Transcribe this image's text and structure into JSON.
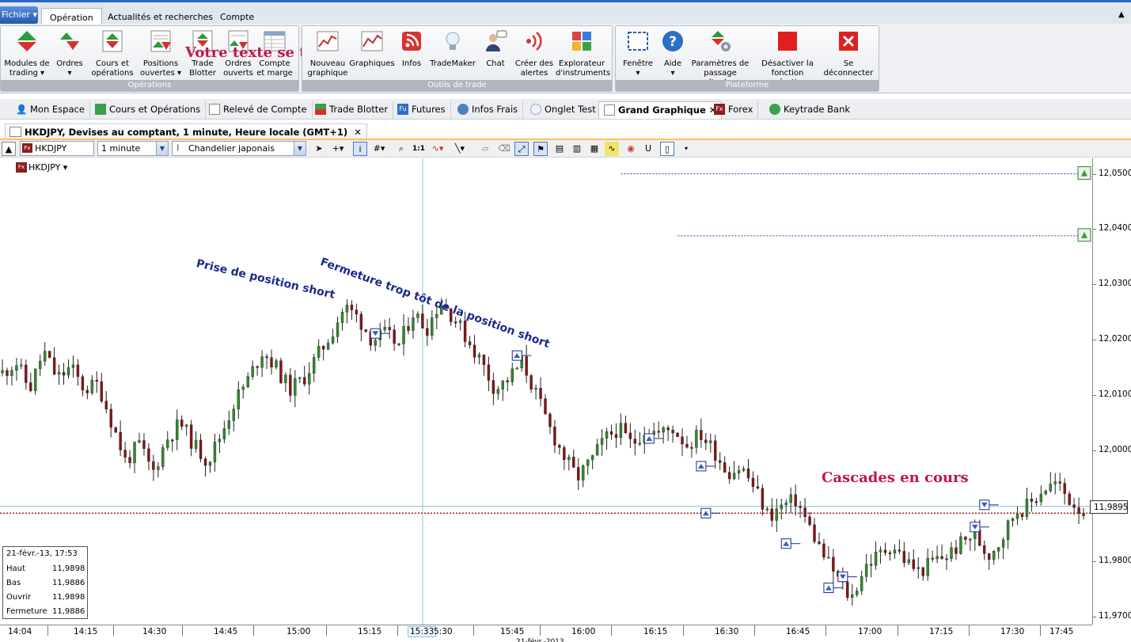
{
  "menu": {
    "file_label": "Fichier",
    "tabs": [
      "Opération",
      "Actualités et recherches",
      "Compte"
    ]
  },
  "ribbon": {
    "operations": {
      "label": "Opérations",
      "buttons": [
        {
          "l1": "Modules de",
          "l2": "trading ▾"
        },
        {
          "l1": "Ordres",
          "l2": "▾"
        },
        {
          "l1": "Cours et",
          "l2": "opérations ▾"
        },
        {
          "l1": "Positions",
          "l2": "ouvertes ▾"
        },
        {
          "l1": "Trade",
          "l2": "Blotter"
        },
        {
          "l1": "Ordres",
          "l2": "ouverts"
        },
        {
          "l1": "Compte",
          "l2": "et marge"
        }
      ]
    },
    "outils": {
      "label": "Outils de trade",
      "buttons": [
        {
          "l1": "Nouveau",
          "l2": "graphique"
        },
        {
          "l1": "Graphiques",
          "l2": ""
        },
        {
          "l1": "Infos",
          "l2": ""
        },
        {
          "l1": "TradeMaker",
          "l2": ""
        },
        {
          "l1": "Chat",
          "l2": ""
        },
        {
          "l1": "Créer des",
          "l2": "alertes"
        },
        {
          "l1": "Explorateur",
          "l2": "d'instruments"
        }
      ]
    },
    "plateforme": {
      "label": "Plateforme",
      "buttons": [
        {
          "l1": "Fenêtre",
          "l2": "▾"
        },
        {
          "l1": "Aide",
          "l2": "▾"
        },
        {
          "l1": "Paramètres de",
          "l2": "passage d'ordre"
        },
        {
          "l1": "Désactiver la",
          "l2": "fonction opération"
        },
        {
          "l1": "Se",
          "l2": "déconnecter"
        }
      ]
    },
    "overlay_text": "Votre texte se trouve ici."
  },
  "workspace_tabs": [
    "Mon Espace",
    "Cours et Opérations",
    "Relevé de Compte",
    "Trade Blotter",
    "Futures",
    "Infos Frais",
    "Onglet Test",
    "Grand Graphique",
    "Forex",
    "Keytrade Bank"
  ],
  "doc_tab": "HKDJPY, Devises au comptant, 1 minute, Heure locale (GMT+1)",
  "chart_toolbar": {
    "symbol": "HKDJPY",
    "interval": "1 minute",
    "chart_style": "Chandelier japonais",
    "fx_badge": "Fx",
    "zoom_label": "1:1"
  },
  "annotations": {
    "a1": "Prise de position short",
    "a2": "Fermeture trop tôt de la position short",
    "a3": "Cascades en cours"
  },
  "ohlc": {
    "date": "21-févr.-13, 17:53",
    "rows": [
      {
        "k": "Haut",
        "v": "11,9898"
      },
      {
        "k": "Bas",
        "v": "11,9886"
      },
      {
        "k": "Ouvrir",
        "v": "11,9898"
      },
      {
        "k": "Fermeture",
        "v": "11,9886"
      }
    ]
  },
  "price_tag": "11,9895",
  "chart_data": {
    "type": "candlestick",
    "symbol": "HKDJPY",
    "x_ticks": [
      "14:04",
      "14:15",
      "14:30",
      "14:45",
      "15:00",
      "15:15",
      "15:33",
      "5:30",
      "15:45",
      "16:00",
      "16:15",
      "16:30",
      "16:45",
      "17:00",
      "17:15",
      "17:30",
      "17:45"
    ],
    "y_ticks": [
      "12,0500",
      "12,0400",
      "12,0300",
      "12,0200",
      "12,0100",
      "12,0000",
      "11,9900",
      "11,9800",
      "11,9700"
    ],
    "date_label": "21-févr.-2013",
    "ylim": [
      11.9685,
      12.0528
    ],
    "last_price": 11.9895,
    "crosshair_time": "15:33",
    "series": [
      {
        "name": "HKDJPY",
        "close_path": [
          12.014,
          12.016,
          12.011,
          12.018,
          12.013,
          12.015,
          12.011,
          12.012,
          12.005,
          11.998,
          12.001,
          11.996,
          12.002,
          12.005,
          12.001,
          11.998,
          12.003,
          12.009,
          12.013,
          12.018,
          12.015,
          12.011,
          12.013,
          12.017,
          12.021,
          12.026,
          12.024,
          12.02,
          12.021,
          12.019,
          12.025,
          12.022,
          12.027,
          12.024,
          12.02,
          12.016,
          12.011,
          12.013,
          12.016,
          12.01,
          12.004,
          11.999,
          11.995,
          11.998,
          12.002,
          12.004,
          12.001,
          12.004,
          12.003,
          12.004,
          12.001,
          12.003,
          12.0,
          11.996,
          11.997,
          11.993,
          11.988,
          11.99,
          11.991,
          11.986,
          11.981,
          11.977,
          11.973,
          11.979,
          11.981,
          11.983,
          11.98,
          11.978,
          11.98,
          11.981,
          11.983,
          11.985,
          11.981,
          11.984,
          11.989,
          11.99,
          11.993,
          11.994,
          11.991,
          11.989
        ],
        "alerts": [
          12.05,
          12.0388
        ]
      }
    ],
    "trade_markers": [
      {
        "time": "15:22",
        "price": 12.022,
        "dir": "down"
      },
      {
        "time": "15:52",
        "price": 12.018,
        "dir": "up"
      },
      {
        "time": "16:20",
        "price": 12.003,
        "dir": "up"
      },
      {
        "time": "16:31",
        "price": 11.998,
        "dir": "up"
      },
      {
        "time": "16:32",
        "price": 11.9895,
        "dir": "up"
      },
      {
        "time": "16:49",
        "price": 11.984,
        "dir": "up"
      },
      {
        "time": "16:58",
        "price": 11.976,
        "dir": "up"
      },
      {
        "time": "17:01",
        "price": 11.978,
        "dir": "down"
      },
      {
        "time": "17:29",
        "price": 11.987,
        "dir": "down"
      },
      {
        "time": "17:31",
        "price": 11.991,
        "dir": "down"
      }
    ]
  }
}
